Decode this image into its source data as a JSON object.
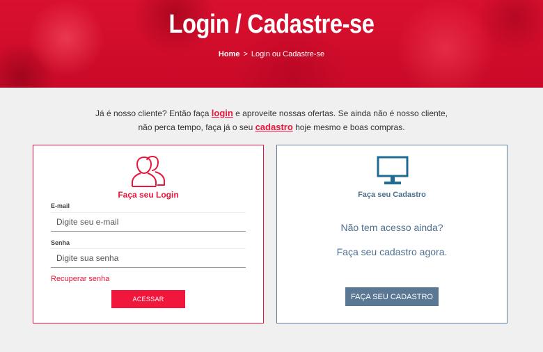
{
  "hero": {
    "title": "Login / Cadastre-se",
    "breadcrumb": {
      "home": "Home",
      "separator": ">",
      "current": "Login ou Cadastre-se"
    }
  },
  "intro": {
    "line1_before": "Já é nosso cliente? Então faça ",
    "line1_link": "login",
    "line1_after": " e aproveite nossas ofertas. Se ainda não é nosso cliente,",
    "line2_before": "não perca tempo, faça já o seu ",
    "line2_link": "cadastro",
    "line2_after": " hoje mesmo e boas compras."
  },
  "login": {
    "icon": "users-icon",
    "title": "Faça seu Login",
    "email_label": "E-mail",
    "email_placeholder": "Digite seu e-mail",
    "email_value": "",
    "password_label": "Senha",
    "password_placeholder": "Digite sua senha",
    "password_value": "",
    "recover_label": "Recuperar senha",
    "submit_label": "ACESSAR"
  },
  "register": {
    "icon": "monitor-icon",
    "title": "Faça seu Cadastro",
    "line1": "Não tem acesso ainda?",
    "line2": "Faça seu cadastro agora.",
    "button_label": "FAÇA SEU CADASTRO"
  },
  "colors": {
    "accent_red": "#e8163a",
    "accent_blue": "#4d6f90",
    "button_blue": "#5a7894",
    "background": "#f1f0f1"
  }
}
